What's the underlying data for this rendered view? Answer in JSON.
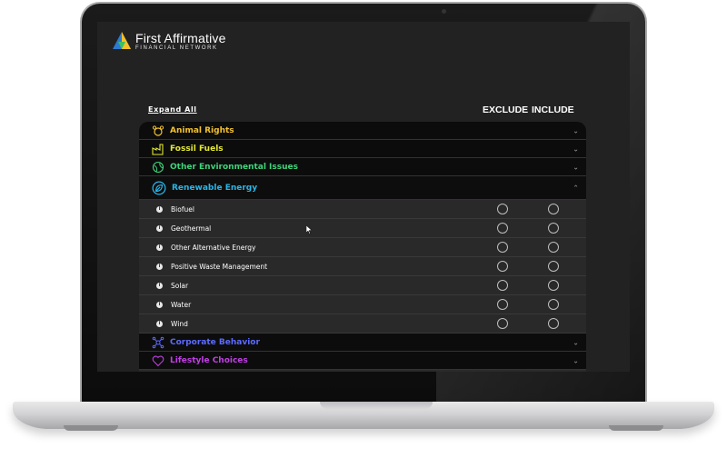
{
  "brand": {
    "title": "First Affirmative",
    "subtitle": "FINANCIAL NETWORK"
  },
  "controls": {
    "expand_all": "Expand All",
    "exclude_header": "EXCLUDE",
    "include_header": "INCLUDE"
  },
  "categories": [
    {
      "label": "Animal Rights",
      "color": "#f2c12e",
      "icon": "animal-icon",
      "chevron": "⌄"
    },
    {
      "label": "Fossil Fuels",
      "color": "#e2e832",
      "icon": "factory-icon",
      "chevron": "⌄"
    },
    {
      "label": "Other Environmental Issues",
      "color": "#3fd47a",
      "icon": "globe-icon",
      "chevron": "⌄"
    },
    {
      "label": "Renewable Energy",
      "color": "#28b6e8",
      "icon": "leaf-icon",
      "chevron": "⌃"
    },
    {
      "label": "Corporate Behavior",
      "color": "#5d6bff",
      "icon": "network-icon",
      "chevron": "⌄"
    },
    {
      "label": "Lifestyle Choices",
      "color": "#c23fe6",
      "icon": "heart-icon",
      "chevron": "⌄"
    }
  ],
  "renewable_items": [
    {
      "label": "Biofuel"
    },
    {
      "label": "Geothermal"
    },
    {
      "label": "Other Alternative Energy"
    },
    {
      "label": "Positive Waste Management"
    },
    {
      "label": "Solar"
    },
    {
      "label": "Water"
    },
    {
      "label": "Wind"
    }
  ],
  "info_glyph": "i"
}
